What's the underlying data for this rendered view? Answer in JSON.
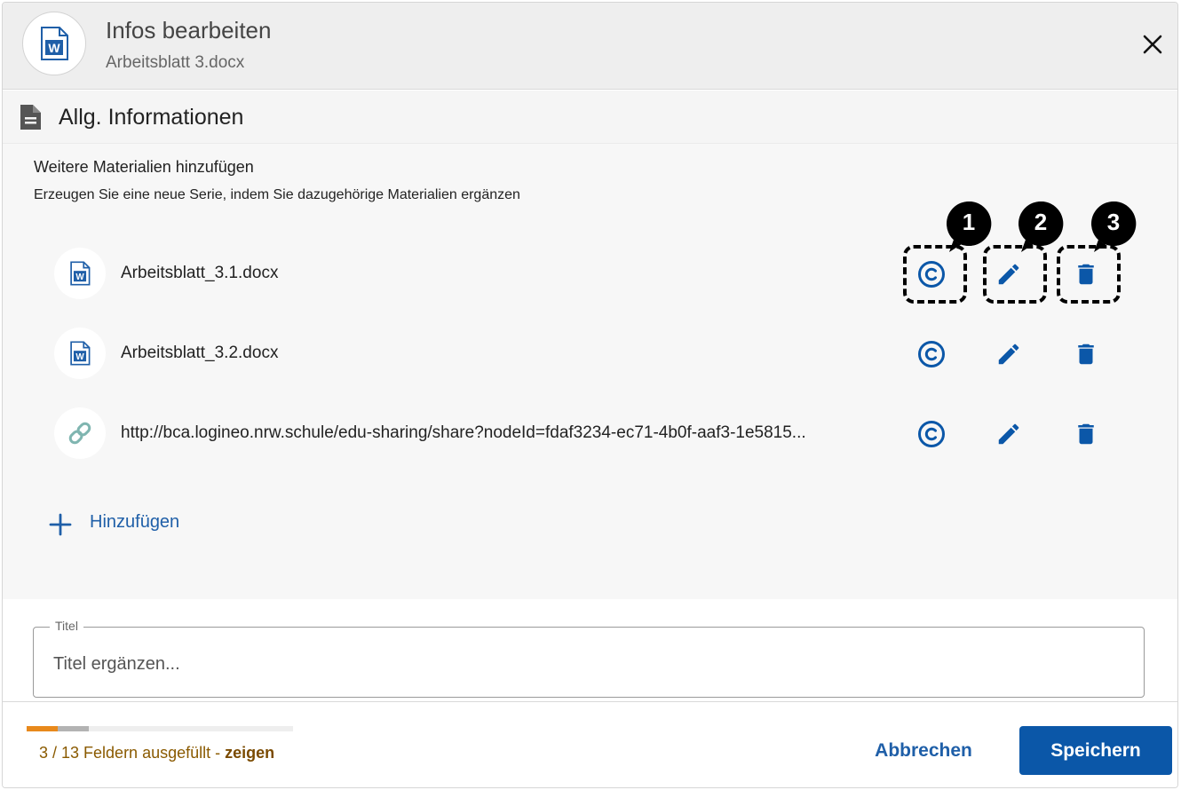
{
  "header": {
    "title": "Infos bearbeiten",
    "subtitle": "Arbeitsblatt 3.docx",
    "avatar_icon": "word-document-icon",
    "close_icon": "close-icon"
  },
  "section": {
    "title": "Allg. Informationen",
    "icon": "document-icon",
    "heading": "Weitere Materialien hinzufügen",
    "description": "Erzeugen Sie eine neue Serie, indem Sie dazugehörige Materialien ergänzen",
    "materials": [
      {
        "label": "Arbeitsblatt_3.1.docx",
        "icon": "word-document-icon"
      },
      {
        "label": "Arbeitsblatt_3.2.docx",
        "icon": "word-document-icon"
      },
      {
        "label": "http://bca.logineo.nrw.schule/edu-sharing/share?nodeId=fdaf3234-ec71-4b0f-aaf3-1e5815...",
        "icon": "link-icon"
      }
    ],
    "actions": [
      "license-icon",
      "edit-icon",
      "delete-icon"
    ],
    "add_label": "Hinzufügen"
  },
  "annotations": [
    "1",
    "2",
    "3"
  ],
  "title_field": {
    "legend": "Titel",
    "placeholder": "Titel ergänzen..."
  },
  "footer": {
    "progress": {
      "filled": 3,
      "total": 13,
      "colors": [
        "#e8891c",
        "#b3b3b3"
      ]
    },
    "progress_text": "3 / 13 Feldern ausgefüllt - ",
    "progress_link": "zeigen",
    "cancel_label": "Abbrechen",
    "save_label": "Speichern"
  },
  "colors": {
    "accent": "#0b57a8",
    "link": "#1f5fa8",
    "progress_text": "#8a5a00"
  }
}
